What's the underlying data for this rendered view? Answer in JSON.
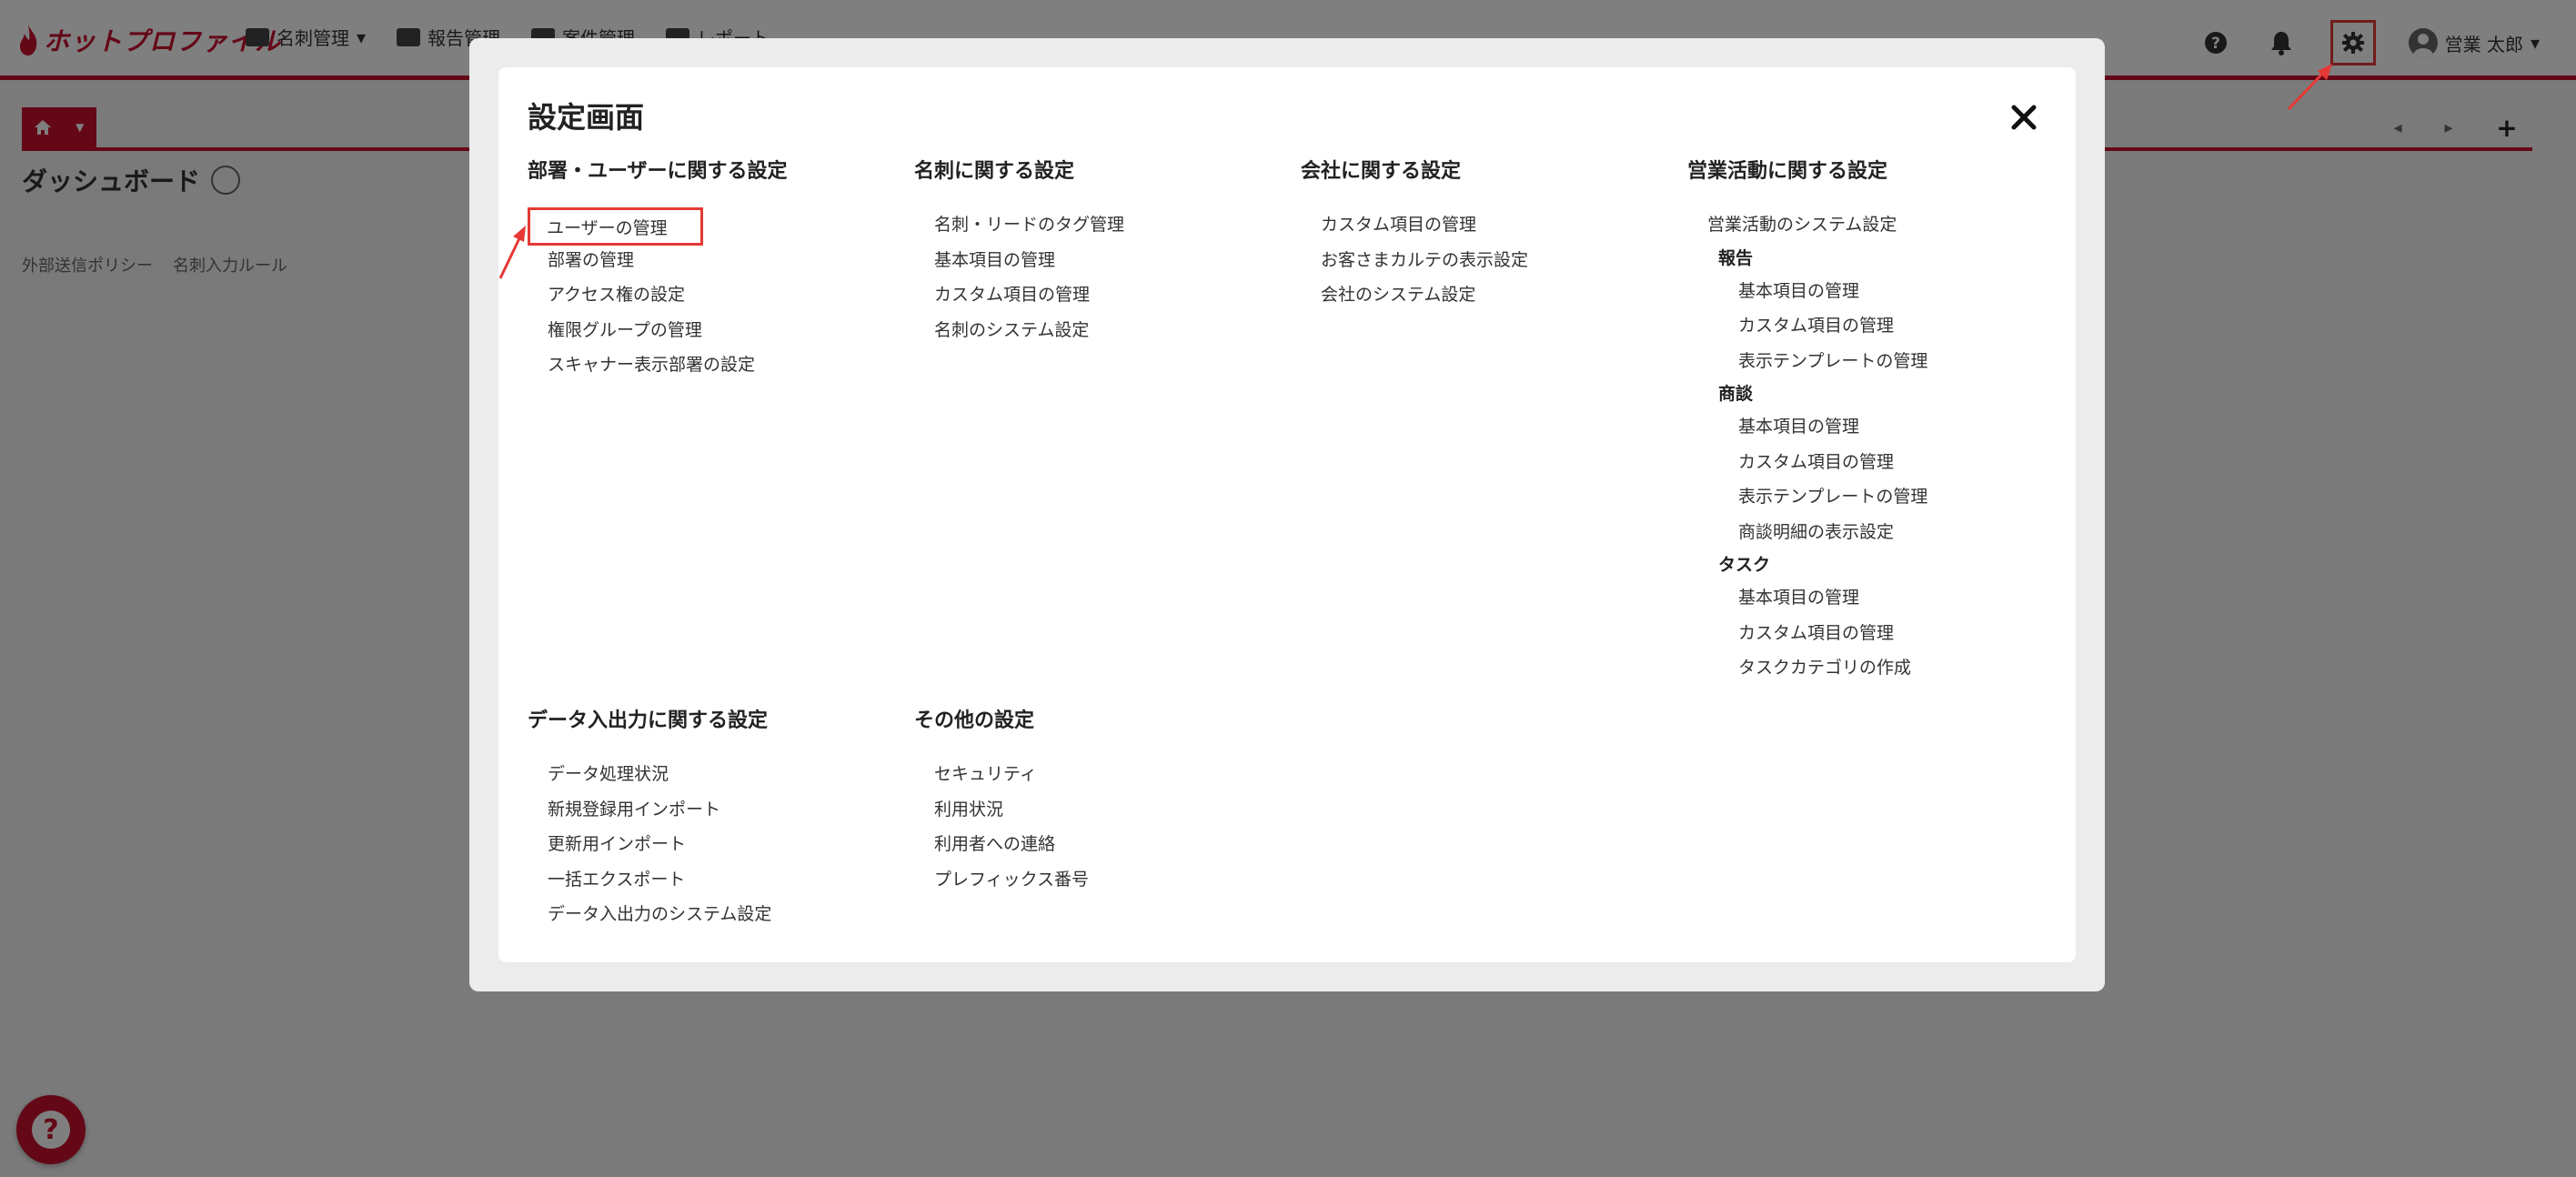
{
  "app": {
    "brand": "ホットプロファイル"
  },
  "header": {
    "nav": [
      {
        "label": "名刺管理",
        "icon": "card-icon"
      },
      {
        "label": "報告管理",
        "icon": "edit-icon"
      },
      {
        "label": "案件管理",
        "icon": "briefcase-icon"
      },
      {
        "label": "レポート",
        "icon": "chart-icon"
      }
    ],
    "user_name": "営業 太郎"
  },
  "page": {
    "title": "ダッシュボード",
    "links": [
      "外部送信ポリシー",
      "名刺入力ルール"
    ]
  },
  "modal": {
    "title": "設定画面",
    "sections": {
      "dept": {
        "title": "部署・ユーザーに関する設定",
        "items": [
          "ユーザーの管理",
          "部署の管理",
          "アクセス権の設定",
          "権限グループの管理",
          "スキャナー表示部署の設定"
        ]
      },
      "card": {
        "title": "名刺に関する設定",
        "items": [
          "名刺・リードのタグ管理",
          "基本項目の管理",
          "カスタム項目の管理",
          "名刺のシステム設定"
        ]
      },
      "company": {
        "title": "会社に関する設定",
        "items": [
          "カスタム項目の管理",
          "お客さまカルテの表示設定",
          "会社のシステム設定"
        ]
      },
      "sales": {
        "title": "営業活動に関する設定",
        "top": "営業活動のシステム設定",
        "groups": [
          {
            "title": "報告",
            "items": [
              "基本項目の管理",
              "カスタム項目の管理",
              "表示テンプレートの管理"
            ]
          },
          {
            "title": "商談",
            "items": [
              "基本項目の管理",
              "カスタム項目の管理",
              "表示テンプレートの管理",
              "商談明細の表示設定"
            ]
          },
          {
            "title": "タスク",
            "items": [
              "基本項目の管理",
              "カスタム項目の管理",
              "タスクカテゴリの作成"
            ]
          }
        ]
      },
      "data": {
        "title": "データ入出力に関する設定",
        "items": [
          "データ処理状況",
          "新規登録用インポート",
          "更新用インポート",
          "一括エクスポート",
          "データ入出力のシステム設定"
        ]
      },
      "other": {
        "title": "その他の設定",
        "items": [
          "セキュリティ",
          "利用状況",
          "利用者への連絡",
          "プレフィックス番号"
        ]
      }
    }
  },
  "colors": {
    "brand": "#c8102e",
    "highlight": "#e53935"
  }
}
